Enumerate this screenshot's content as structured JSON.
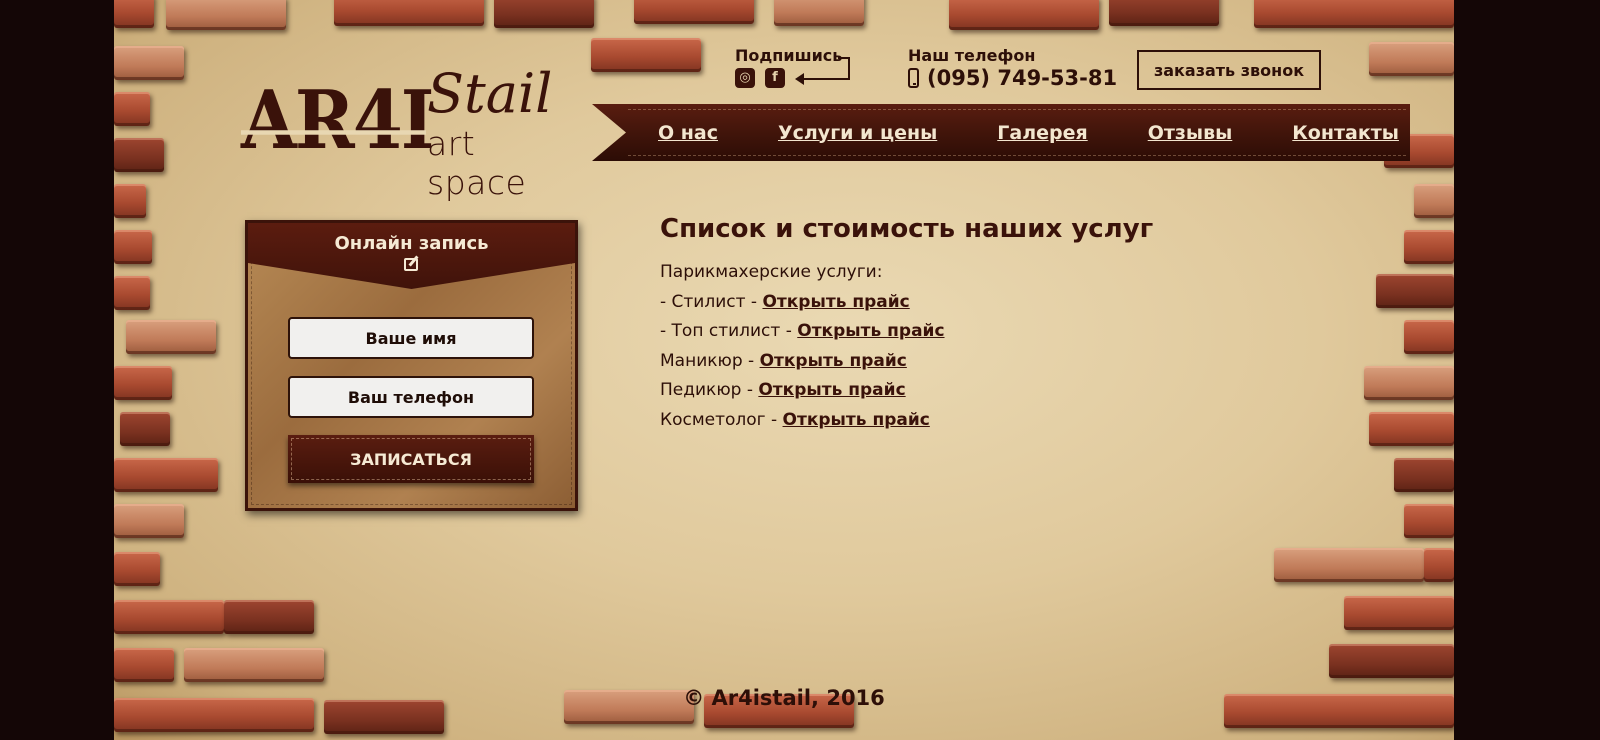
{
  "logo": {
    "mark": "AR4I",
    "word": "Stail",
    "tagline": "art space"
  },
  "header": {
    "subscribe_label": "Подпишись",
    "social_icons": [
      "instagram-icon",
      "facebook-icon"
    ],
    "phone_label": "Наш телефон",
    "phone_number": "(095) 749-53-81",
    "callback_button": "заказать звонок"
  },
  "nav": {
    "items": [
      "О нас",
      "Услуги и цены",
      "Галерея",
      "Отзывы",
      "Контакты"
    ]
  },
  "booking": {
    "title": "Онлайн запись",
    "name_placeholder": "Ваше имя",
    "phone_placeholder": "Ваш телефон",
    "submit": "ЗАПИСАТЬСЯ"
  },
  "services": {
    "title": "Список и стоимость наших услуг",
    "heading_hair": "Парикмахерские услуги:",
    "items": [
      {
        "label": "- Стилист - ",
        "link": "Открыть прайс"
      },
      {
        "label": "- Топ стилист - ",
        "link": "Открыть прайс"
      },
      {
        "label": "Маникюр - ",
        "link": "Открыть прайс"
      },
      {
        "label": "Педикюр - ",
        "link": "Открыть прайс"
      },
      {
        "label": "Косметолог - ",
        "link": "Открыть прайс"
      }
    ]
  },
  "footer": {
    "copyright": "© Ar4istail, 2016"
  },
  "colors": {
    "page_bg": "#140606",
    "text_dark": "#2d0f08",
    "leather": "#40130a",
    "paper": "#e0c99c",
    "brick": "#a94a30"
  }
}
